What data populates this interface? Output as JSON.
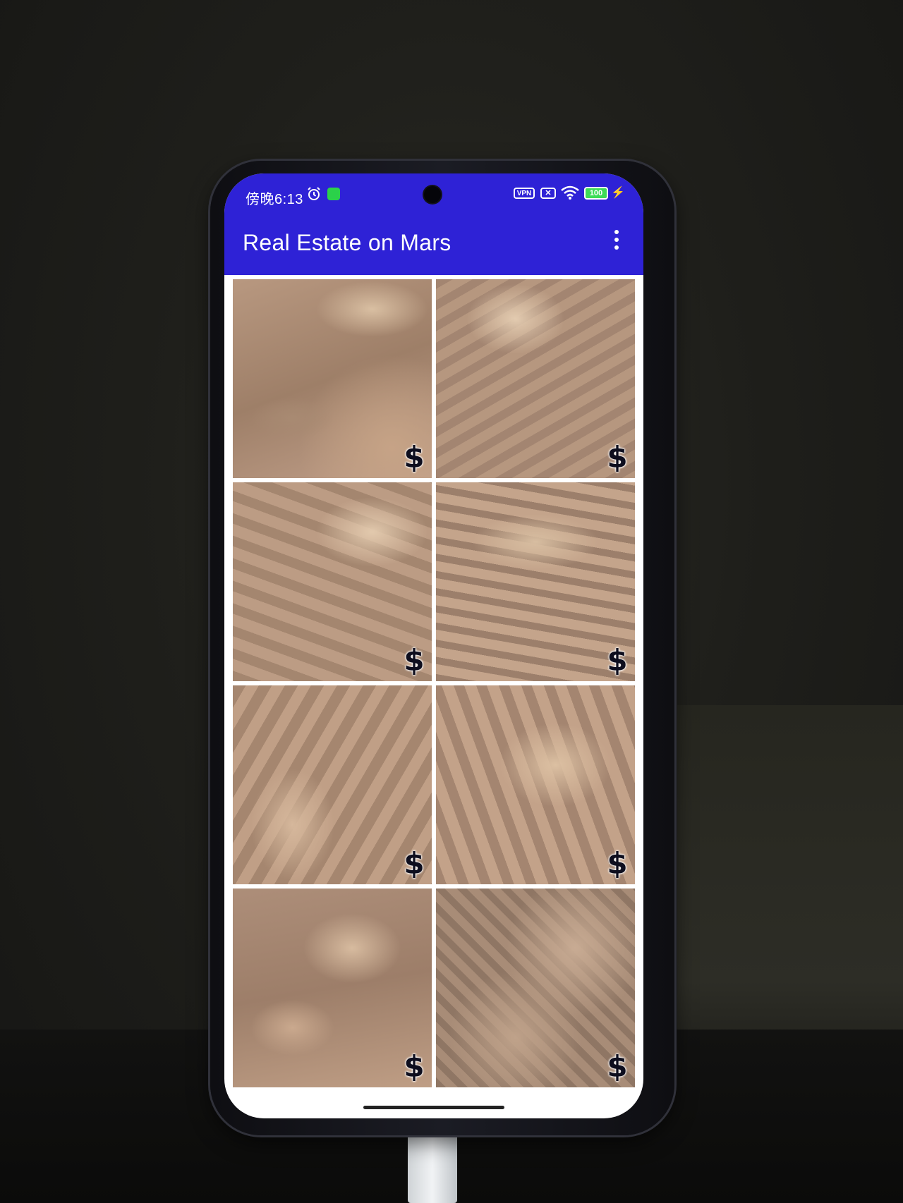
{
  "status_bar": {
    "time": "傍晚6:13",
    "vpn_label": "VPN",
    "sim_label": "✕",
    "battery": "100",
    "icons": [
      "alarm-icon",
      "app-notification-icon",
      "vpn-icon",
      "sim-icon",
      "wifi-icon",
      "battery-icon",
      "charging-icon"
    ]
  },
  "app_bar": {
    "title": "Real Estate on Mars",
    "menu_icon": "overflow-menu-icon"
  },
  "grid": {
    "tiles": [
      {
        "price_icon": "$",
        "image": "mars-rock-1"
      },
      {
        "price_icon": "$",
        "image": "mars-rock-2"
      },
      {
        "price_icon": "$",
        "image": "mars-rock-3"
      },
      {
        "price_icon": "$",
        "image": "mars-rock-4"
      },
      {
        "price_icon": "$",
        "image": "mars-rock-5"
      },
      {
        "price_icon": "$",
        "image": "mars-rock-6"
      },
      {
        "price_icon": "$",
        "image": "mars-rock-7"
      },
      {
        "price_icon": "$",
        "image": "mars-rock-8"
      }
    ]
  },
  "colors": {
    "app_bar": "#2e22d6",
    "price_icon": "#0e0e1e",
    "battery": "#3ddc57"
  }
}
